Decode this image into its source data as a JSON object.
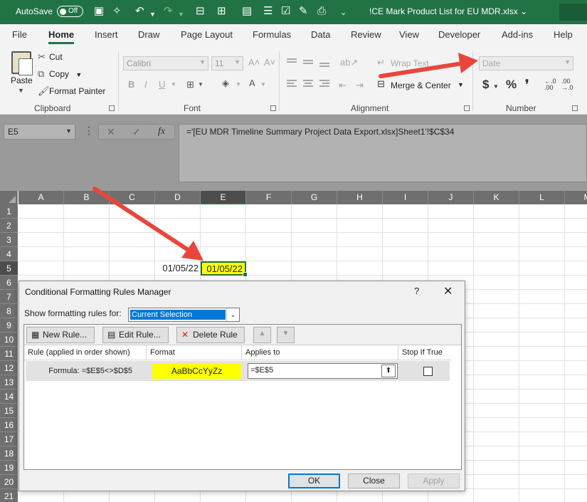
{
  "titlebar": {
    "autosave_label": "AutoSave",
    "toggle_label": "Off",
    "filename": "!CE Mark Product List for EU MDR.xlsx",
    "filename_caret": "⌄"
  },
  "menu": {
    "tabs": [
      "File",
      "Home",
      "Insert",
      "Draw",
      "Page Layout",
      "Formulas",
      "Data",
      "Review",
      "View",
      "Developer",
      "Add-ins",
      "Help"
    ],
    "active_tab": "Home"
  },
  "ribbon": {
    "clipboard": {
      "paste_label": "Paste",
      "cut_label": "Cut",
      "copy_label": "Copy",
      "format_painter_label": "Format Painter",
      "group_label": "Clipboard"
    },
    "font": {
      "font_name": "Calibri",
      "font_size": "11",
      "group_label": "Font"
    },
    "alignment": {
      "wrap_text_label": "Wrap Text",
      "merge_center_label": "Merge & Center",
      "group_label": "Alignment"
    },
    "number": {
      "format_value": "Date",
      "group_label": "Number",
      "currency_symbol": "$",
      "percent_symbol": "%",
      "comma_symbol": "❜"
    }
  },
  "formula_bar": {
    "name_box": "E5",
    "fx_label": "fx",
    "formula": "='[EU MDR Timeline Summary Project Data Export.xlsx]Sheet1'!$C$34"
  },
  "grid": {
    "columns": [
      "A",
      "B",
      "C",
      "D",
      "E",
      "F",
      "G",
      "H",
      "I",
      "J",
      "K",
      "L",
      "M"
    ],
    "rows": [
      "1",
      "2",
      "3",
      "4",
      "5",
      "6",
      "7",
      "8",
      "9",
      "10",
      "11",
      "12",
      "13",
      "14",
      "15",
      "16",
      "17",
      "18",
      "19",
      "20",
      "21"
    ],
    "selected_column": "E",
    "selected_row": "5",
    "cell_d5": "01/05/22",
    "cell_e5": "01/05/22",
    "highlight_color": "#ffff00"
  },
  "dialog": {
    "title": "Conditional Formatting Rules Manager",
    "help": "?",
    "close": "✕",
    "show_rules_label": "Show formatting rules for:",
    "show_rules_value": "Current Selection",
    "new_rule_label": "New Rule...",
    "edit_rule_label": "Edit Rule...",
    "delete_rule_label": "Delete Rule",
    "columns": [
      "Rule (applied in order shown)",
      "Format",
      "Applies to",
      "Stop If True"
    ],
    "rule": {
      "formula": "Formula: =$E$5<>$D$5",
      "preview": "AaBbCcYyZz",
      "applies_to": "=$E$5"
    },
    "ok_label": "OK",
    "close_label": "Close",
    "apply_label": "Apply"
  },
  "colors": {
    "excel_green": "#217346",
    "arrow_red": "#e8463c",
    "selection_blue": "#0078d7"
  }
}
